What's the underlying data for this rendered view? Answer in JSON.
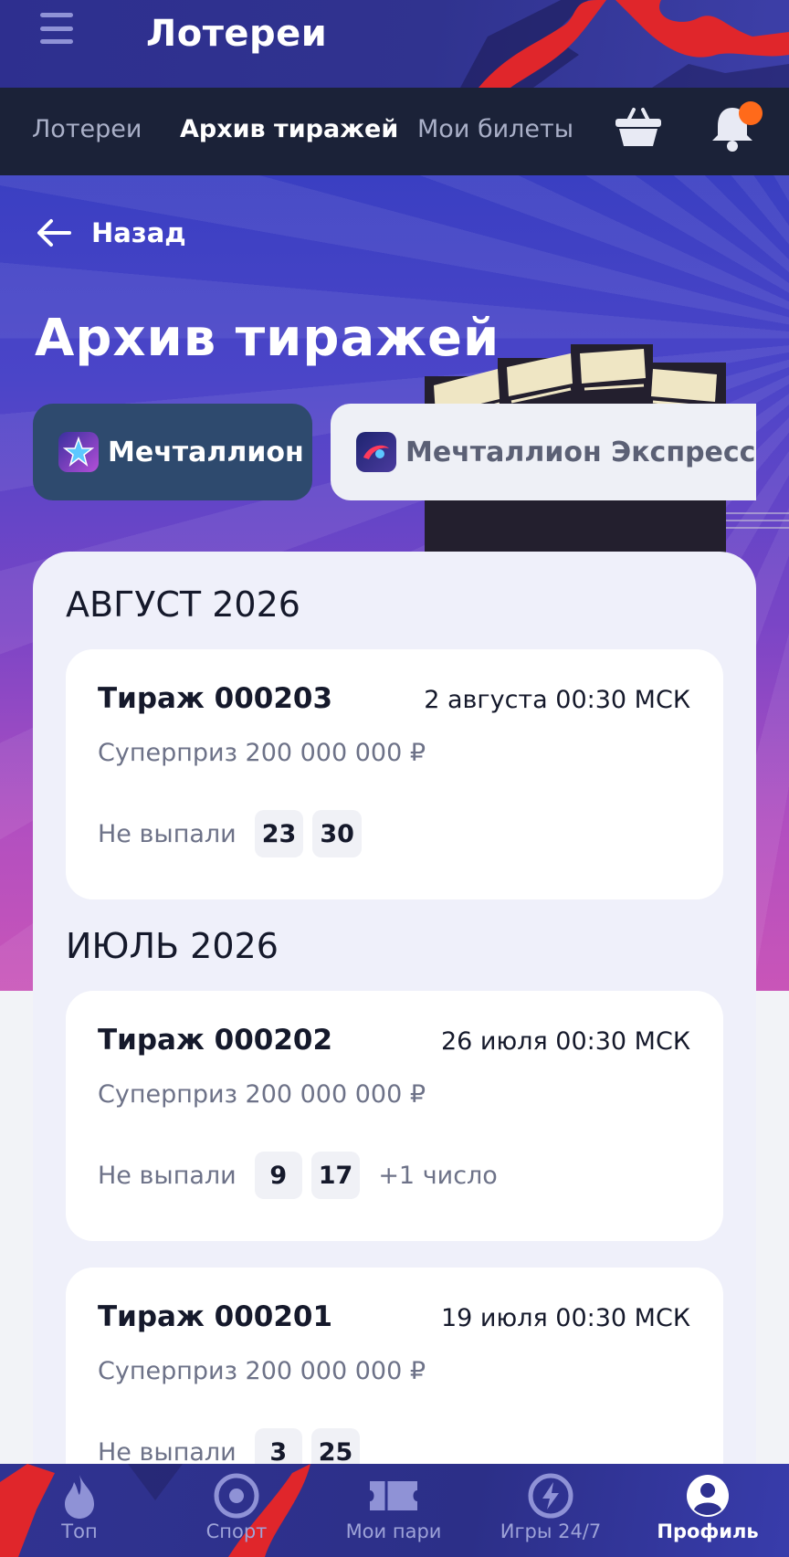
{
  "header": {
    "title": "Лотереи",
    "menu_icon": "hamburger-icon"
  },
  "subnav": {
    "tabs": [
      {
        "label": "Лотереи",
        "active": false
      },
      {
        "label": "Архив тиражей",
        "active": true
      },
      {
        "label": "Мои билеты",
        "active": false
      }
    ],
    "basket_icon": "basket-icon",
    "bell_icon": "bell-icon",
    "bell_badge_color": "#ff6a1a"
  },
  "hero": {
    "back_label": "Назад",
    "title": "Архив тиражей",
    "chips": [
      {
        "label": "Мечталлион",
        "icon": "star-icon",
        "active": true
      },
      {
        "label": "Мечталлион Экспресс (д",
        "icon": "express-icon",
        "active": false
      }
    ]
  },
  "archive": {
    "months": [
      {
        "label": "АВГУСТ 2026",
        "draws": [
          {
            "name": "Тираж 000203",
            "date": "2 августа 00:30 МСК",
            "prize": "Суперприз 200 000 000 ₽",
            "missed_label": "Не выпали",
            "numbers": [
              "23",
              "30"
            ],
            "extra": ""
          }
        ]
      },
      {
        "label": "ИЮЛЬ 2026",
        "draws": [
          {
            "name": "Тираж 000202",
            "date": "26 июля 00:30 МСК",
            "prize": "Суперприз 200 000 000 ₽",
            "missed_label": "Не выпали",
            "numbers": [
              "9",
              "17"
            ],
            "extra": "+1 число"
          },
          {
            "name": "Тираж 000201",
            "date": "19 июля 00:30 МСК",
            "prize": "Суперприз 200 000 000 ₽",
            "missed_label": "Не выпали",
            "numbers": [
              "3",
              "25"
            ],
            "extra": ""
          }
        ]
      }
    ]
  },
  "bottom_nav": {
    "items": [
      {
        "label": "Топ",
        "icon": "flame-icon",
        "active": false
      },
      {
        "label": "Спорт",
        "icon": "target-icon",
        "active": false
      },
      {
        "label": "Мои пари",
        "icon": "ticket-icon",
        "active": false
      },
      {
        "label": "Игры 24/7",
        "icon": "lightning-icon",
        "active": false
      },
      {
        "label": "Профиль",
        "icon": "profile-icon",
        "active": true
      }
    ]
  },
  "colors": {
    "header_bg": "#2e2f8f",
    "subnav_bg": "#1b2238",
    "active_chip_bg": "#2e4a6e",
    "accent_red": "#e0262b"
  }
}
